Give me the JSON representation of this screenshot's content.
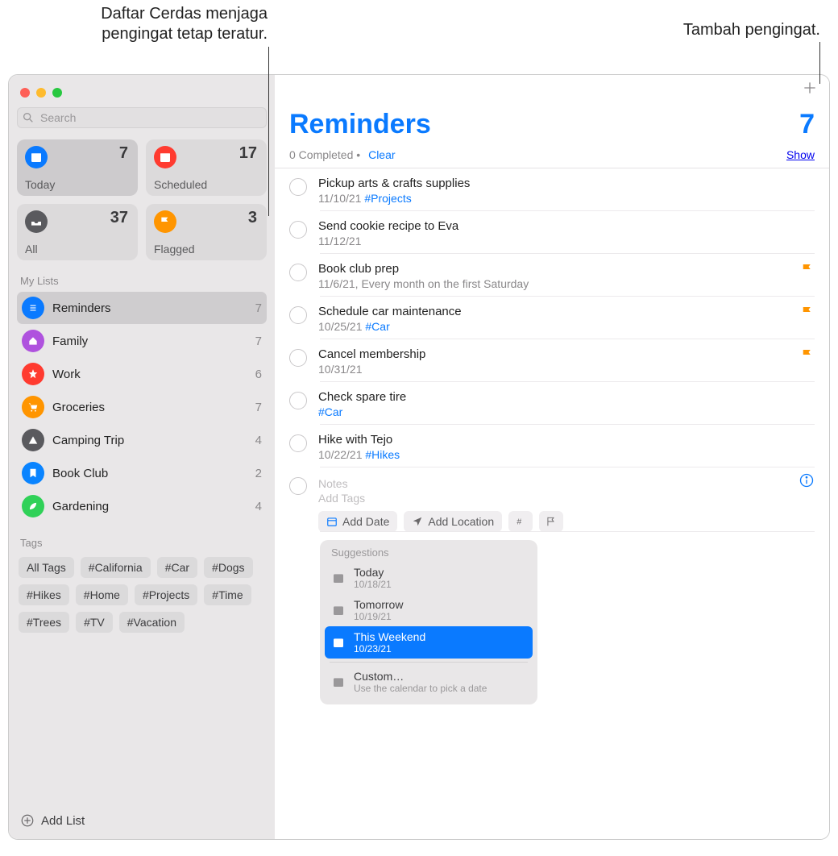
{
  "callouts": {
    "left": "Daftar Cerdas menjaga pengingat tetap teratur.",
    "right": "Tambah pengingat."
  },
  "sidebar": {
    "search_placeholder": "Search",
    "smart": [
      {
        "label": "Today",
        "count": "7",
        "icon": "calendar",
        "color": "bg-blue"
      },
      {
        "label": "Scheduled",
        "count": "17",
        "icon": "calendar",
        "color": "bg-red"
      },
      {
        "label": "All",
        "count": "37",
        "icon": "tray",
        "color": "bg-gray"
      },
      {
        "label": "Flagged",
        "count": "3",
        "icon": "flag",
        "color": "bg-orange"
      }
    ],
    "mylists_header": "My Lists",
    "lists": [
      {
        "name": "Reminders",
        "count": "7",
        "color": "bg-blue",
        "icon": "list"
      },
      {
        "name": "Family",
        "count": "7",
        "color": "#af52de",
        "icon": "home"
      },
      {
        "name": "Work",
        "count": "6",
        "color": "#ff3b30",
        "icon": "star"
      },
      {
        "name": "Groceries",
        "count": "7",
        "color": "#ff9500",
        "icon": "cart"
      },
      {
        "name": "Camping Trip",
        "count": "4",
        "color": "#5a5a5e",
        "icon": "tent"
      },
      {
        "name": "Book Club",
        "count": "2",
        "color": "#0a84ff",
        "icon": "bookmark"
      },
      {
        "name": "Gardening",
        "count": "4",
        "color": "#30d158",
        "icon": "leaf"
      }
    ],
    "tags_header": "Tags",
    "tags": [
      "All Tags",
      "#California",
      "#Car",
      "#Dogs",
      "#Hikes",
      "#Home",
      "#Projects",
      "#Time",
      "#Trees",
      "#TV",
      "#Vacation"
    ],
    "add_list": "Add List"
  },
  "main": {
    "title": "Reminders",
    "count": "7",
    "completed": "0 Completed",
    "clear": "Clear",
    "show": "Show",
    "items": [
      {
        "title": "Pickup arts & crafts supplies",
        "meta": "11/10/21 ",
        "tag": "#Projects",
        "flag": false
      },
      {
        "title": "Send cookie recipe to Eva",
        "meta": "11/12/21",
        "tag": "",
        "flag": false
      },
      {
        "title": "Book club prep",
        "meta": "11/6/21, Every month on the first Saturday",
        "tag": "",
        "flag": true
      },
      {
        "title": "Schedule car maintenance",
        "meta": "10/25/21 ",
        "tag": "#Car",
        "flag": true
      },
      {
        "title": "Cancel membership",
        "meta": "10/31/21",
        "tag": "",
        "flag": true
      },
      {
        "title": "Check spare tire",
        "meta": "",
        "tag": "#Car",
        "flag": false
      },
      {
        "title": "Hike with Tejo",
        "meta": "10/22/21 ",
        "tag": "#Hikes",
        "flag": false
      }
    ],
    "new": {
      "notes": "Notes",
      "addtags": "Add Tags",
      "adddate": "Add Date",
      "addloc": "Add Location"
    },
    "suggestions": {
      "header": "Suggestions",
      "rows": [
        {
          "name": "Today",
          "detail": "10/18/21",
          "sel": false
        },
        {
          "name": "Tomorrow",
          "detail": "10/19/21",
          "sel": false
        },
        {
          "name": "This Weekend",
          "detail": "10/23/21",
          "sel": true
        }
      ],
      "custom": {
        "name": "Custom…",
        "detail": "Use the calendar to pick a date"
      }
    }
  }
}
